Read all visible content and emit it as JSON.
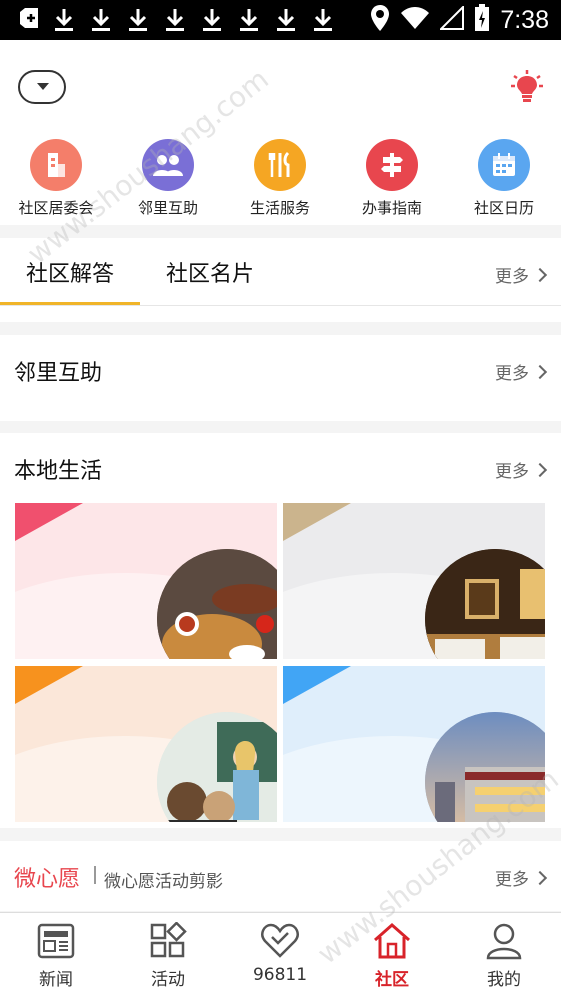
{
  "status_bar": {
    "time": "7:38",
    "icons": [
      "notification-icon",
      "download-icon",
      "location-icon",
      "wifi-icon",
      "signal-icon",
      "battery-icon"
    ]
  },
  "header": {
    "dropdown_icon": "caret-down-icon",
    "action_icon": "lightbulb-icon"
  },
  "quick_nav": [
    {
      "label": "社区居委会",
      "icon": "building-icon",
      "color": "#f47e6a"
    },
    {
      "label": "邻里互助",
      "icon": "people-icon",
      "color": "#7a6fd6"
    },
    {
      "label": "生活服务",
      "icon": "utensils-icon",
      "color": "#f5a623"
    },
    {
      "label": "办事指南",
      "icon": "signpost-icon",
      "color": "#e8464e"
    },
    {
      "label": "社区日历",
      "icon": "calendar-icon",
      "color": "#5aa6f0"
    }
  ],
  "tabs": {
    "items": [
      {
        "label": "社区解答"
      },
      {
        "label": "社区名片"
      }
    ],
    "more": "更多"
  },
  "neighbor": {
    "title": "邻里互助",
    "more": "更多"
  },
  "local": {
    "title": "本地生活",
    "more": "更多",
    "cards": [
      {
        "name": "food",
        "accent": "#f0506e",
        "bg": "#fde6e8"
      },
      {
        "name": "hotel",
        "accent": "#cbb48d",
        "bg": "#ebebed"
      },
      {
        "name": "education",
        "accent": "#f7921e",
        "bg": "#fbe7d9"
      },
      {
        "name": "shopping",
        "accent": "#41a5f5",
        "bg": "#dfeefb"
      }
    ]
  },
  "micro_wish": {
    "title": "微心愿",
    "subtitle": "微心愿活动剪影",
    "more": "更多"
  },
  "bottom_nav": [
    {
      "label": "新闻",
      "icon": "news-icon"
    },
    {
      "label": "活动",
      "icon": "apps-icon"
    },
    {
      "label": "96811",
      "icon": "heart-icon"
    },
    {
      "label": "社区",
      "icon": "home-icon",
      "active": true
    },
    {
      "label": "我的",
      "icon": "profile-icon"
    }
  ],
  "colors": {
    "accent": "#d8232a",
    "tab_underline": "#f0b429",
    "micro_wish_title": "#e8464e"
  }
}
